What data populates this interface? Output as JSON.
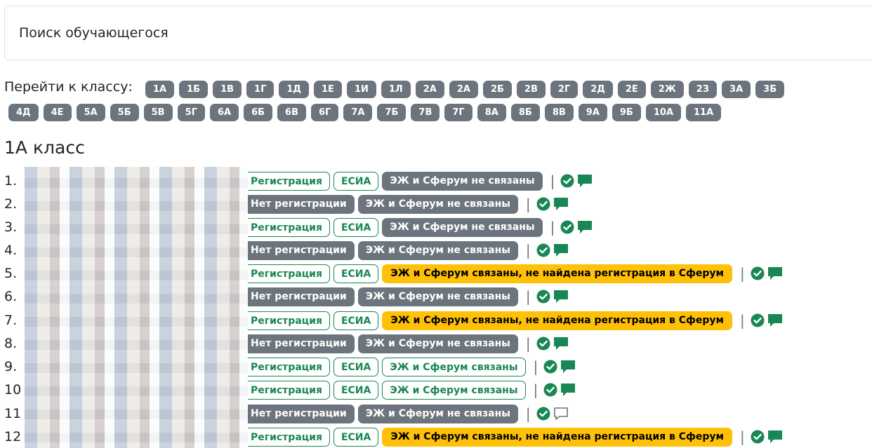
{
  "search": {
    "placeholder": "Поиск обучающегося"
  },
  "goto": {
    "label": "Перейти к классу:",
    "classes_row1": [
      "1А",
      "1Б",
      "1В",
      "1Г",
      "1Д",
      "1Е",
      "1И",
      "1Л",
      "2А",
      "2А",
      "2Б",
      "2В",
      "2Г",
      "2Д",
      "2Е",
      "2Ж",
      "2З",
      "3А",
      "3Б"
    ],
    "classes_row2": [
      "4Д",
      "4Е",
      "5А",
      "5Б",
      "5В",
      "5Г",
      "6А",
      "6Б",
      "6В",
      "6Г",
      "7А",
      "7Б",
      "7В",
      "7Г",
      "8А",
      "8Б",
      "8В",
      "9А",
      "9Б",
      "10А",
      "11А"
    ]
  },
  "class_title": "1А класс",
  "students": [
    {
      "num": "1.",
      "frag": "",
      "badges": [
        [
          "o",
          "Регистрация"
        ],
        [
          "o",
          "ЕСИА"
        ],
        [
          "g",
          "ЭЖ и Сферум не связаны"
        ]
      ],
      "chat": "filled"
    },
    {
      "num": "2.",
      "frag": "",
      "badges": [
        [
          "g",
          "Нет регистрации"
        ],
        [
          "g",
          "ЭЖ и Сферум не связаны"
        ]
      ],
      "chat": "filled"
    },
    {
      "num": "3.",
      "frag": "",
      "badges": [
        [
          "o",
          "Регистрация"
        ],
        [
          "o",
          "ЕСИА"
        ],
        [
          "g",
          "ЭЖ и Сферум не связаны"
        ]
      ],
      "chat": "filled"
    },
    {
      "num": "4.",
      "frag": "н",
      "badges": [
        [
          "g",
          "Нет регистрации"
        ],
        [
          "g",
          "ЭЖ и Сферум не связаны"
        ]
      ],
      "chat": "filled"
    },
    {
      "num": "5.",
      "frag": "н",
      "badges": [
        [
          "o",
          "Регистрация"
        ],
        [
          "o",
          "ЕСИА"
        ],
        [
          "w",
          "ЭЖ и Сферум связаны, не найдена регистрация в Сферум"
        ]
      ],
      "chat": "filled"
    },
    {
      "num": "6.",
      "frag": "а",
      "badges": [
        [
          "g",
          "Нет регистрации"
        ],
        [
          "g",
          "ЭЖ и Сферум не связаны"
        ]
      ],
      "chat": "filled"
    },
    {
      "num": "7.",
      "frag": "новна",
      "badges": [
        [
          "o",
          "Регистрация"
        ],
        [
          "o",
          "ЕСИА"
        ],
        [
          "w",
          "ЭЖ и Сферум связаны, не найдена регистрация в Сферум"
        ]
      ],
      "chat": "filled"
    },
    {
      "num": "8.",
      "frag": "",
      "badges": [
        [
          "g",
          "Нет регистрации"
        ],
        [
          "g",
          "ЭЖ и Сферум не связаны"
        ]
      ],
      "chat": "filled"
    },
    {
      "num": "9.",
      "frag": "вна",
      "badges": [
        [
          "o",
          "Регистрация"
        ],
        [
          "o",
          "ЕСИА"
        ],
        [
          "o",
          "ЭЖ и Сферум связаны"
        ]
      ],
      "chat": "filled"
    },
    {
      "num": "10",
      "frag": "",
      "badges": [
        [
          "o",
          "Регистрация"
        ],
        [
          "o",
          "ЕСИА"
        ],
        [
          "o",
          "ЭЖ и Сферум связаны"
        ]
      ],
      "chat": "filled"
    },
    {
      "num": "11",
      "frag": "",
      "badges": [
        [
          "g",
          "Нет регистрации"
        ],
        [
          "g",
          "ЭЖ и Сферум не связаны"
        ]
      ],
      "chat": "outline"
    },
    {
      "num": "12",
      "frag": "",
      "badges": [
        [
          "o",
          "Регистрация"
        ],
        [
          "o",
          "ЕСИА"
        ],
        [
          "w",
          "ЭЖ и Сферум связаны, не найдена регистрация в Сферум"
        ]
      ],
      "chat": "filled"
    }
  ],
  "colors": {
    "success": "#198754",
    "secondary": "#6c757d",
    "warning": "#ffc107"
  },
  "icons": {
    "status": "check-circle-icon",
    "message": "chat-icon"
  }
}
